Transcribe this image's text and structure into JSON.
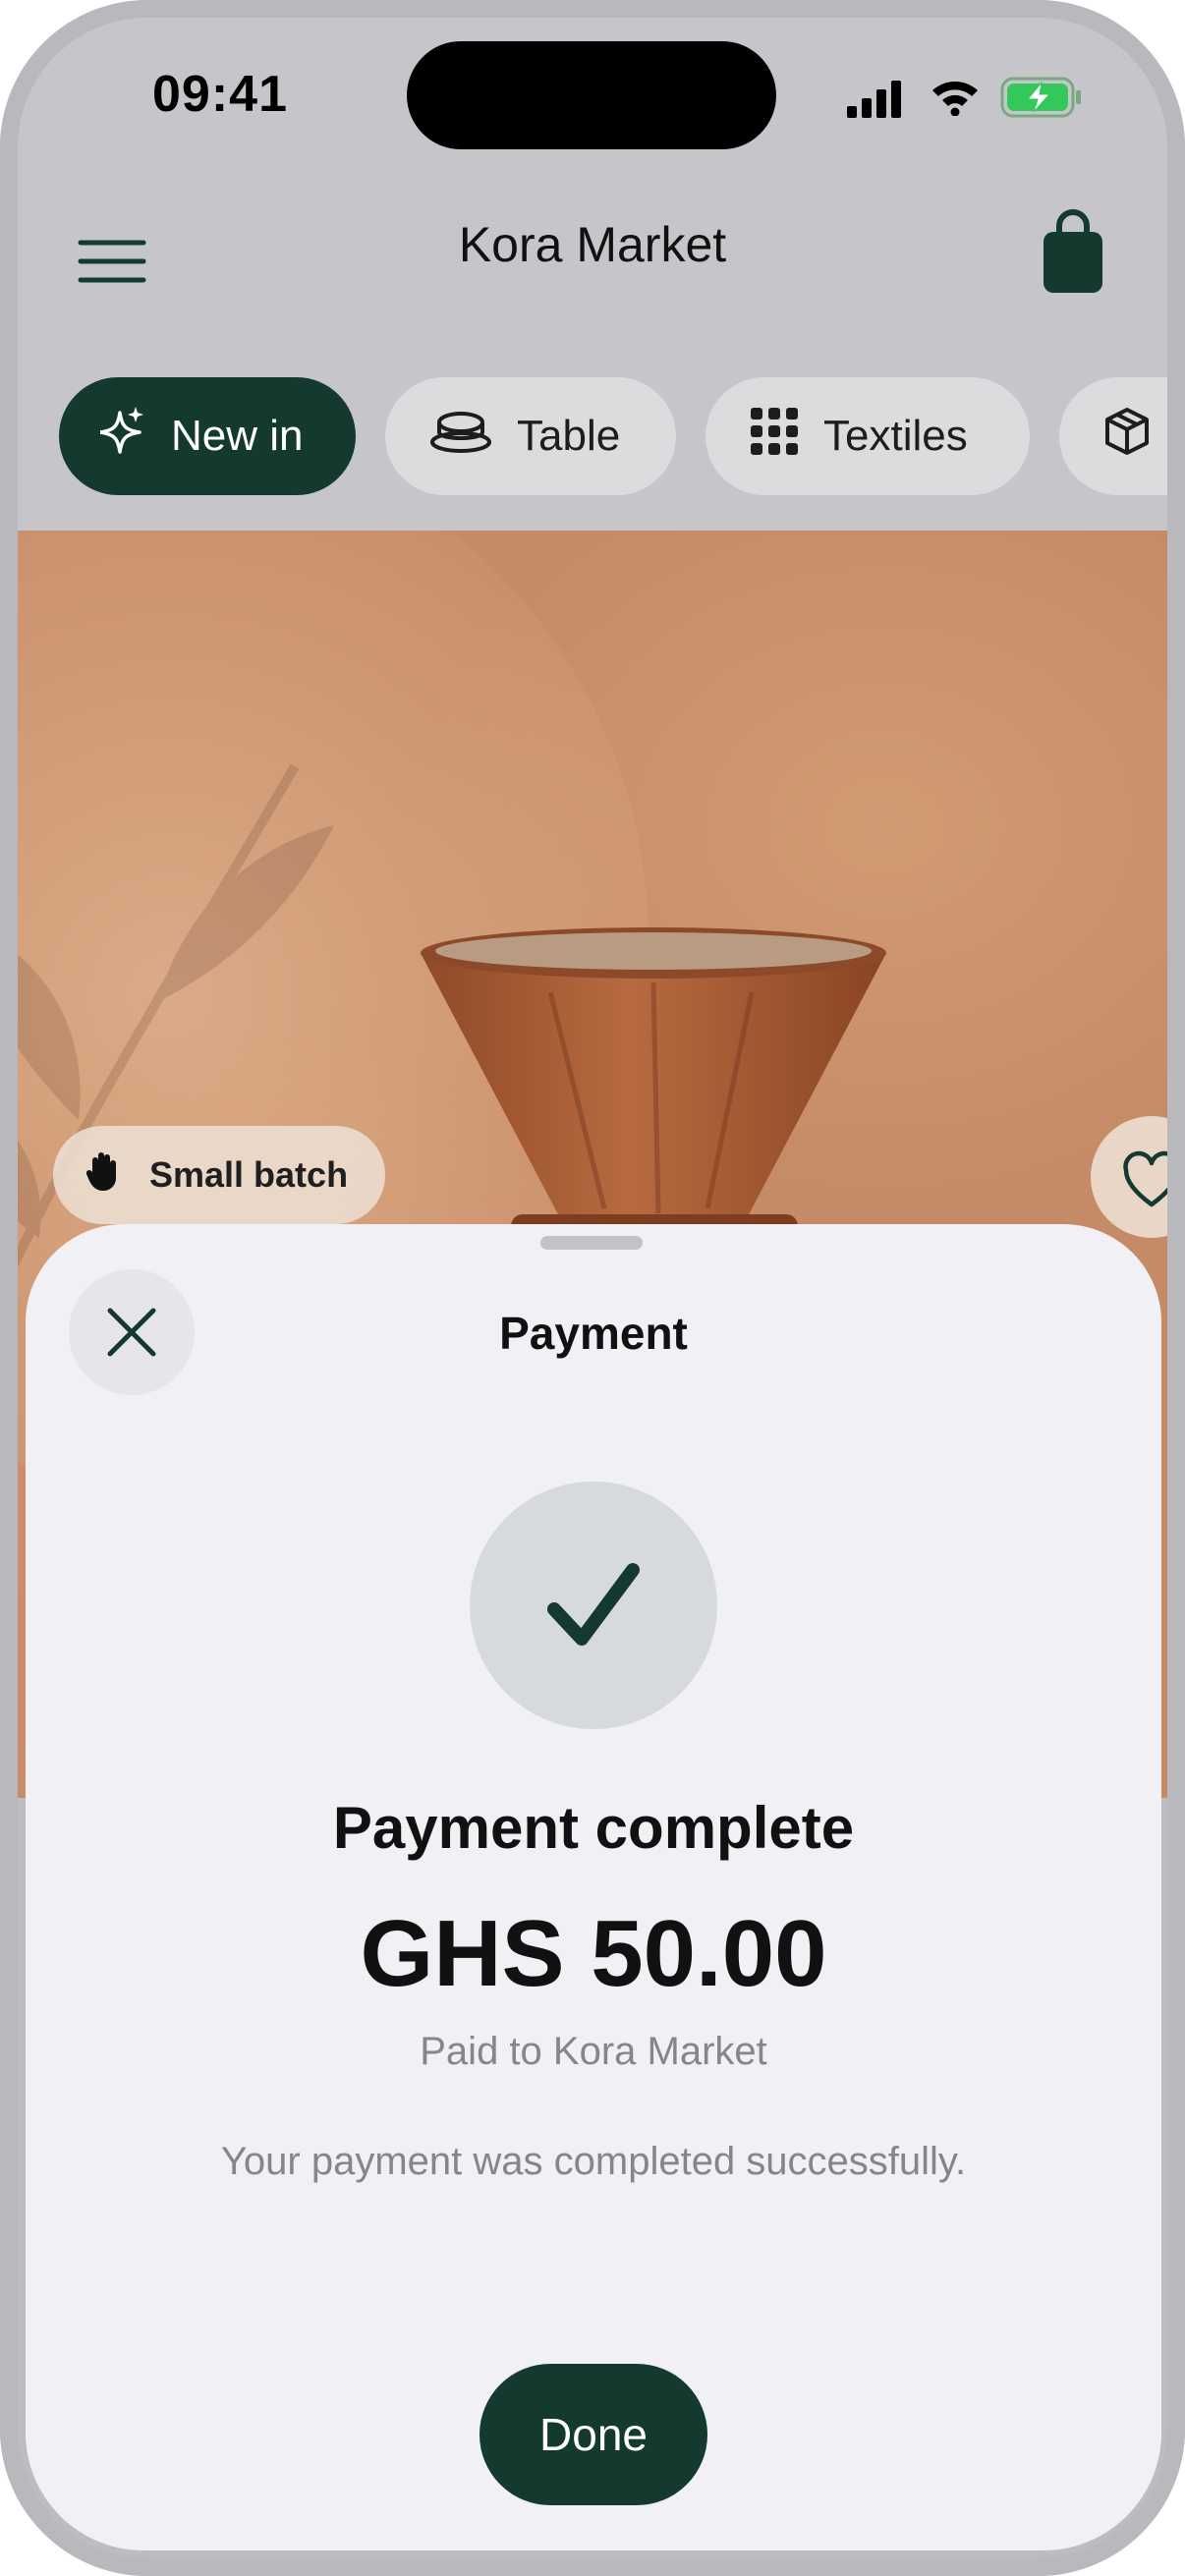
{
  "status_bar": {
    "time": "09:41"
  },
  "header": {
    "title": "Kora Market"
  },
  "chips": [
    {
      "label": "New in",
      "icon": "sparkle-icon",
      "active": true
    },
    {
      "label": "Table",
      "icon": "cup-icon"
    },
    {
      "label": "Textiles",
      "icon": "grid-icon"
    },
    {
      "label": "",
      "icon": "box-icon"
    }
  ],
  "hero": {
    "badge_label": "Small batch",
    "badge_icon": "hand-icon"
  },
  "sheet": {
    "title": "Payment",
    "status_heading": "Payment complete",
    "amount": "GHS 50.00",
    "paid_to": "Paid to Kora Market",
    "message": "Your payment was completed successfully.",
    "done_label": "Done"
  },
  "colors": {
    "accent": "#14392f",
    "sheet_background": "#f0f0f5",
    "battery_green": "#34c759"
  }
}
